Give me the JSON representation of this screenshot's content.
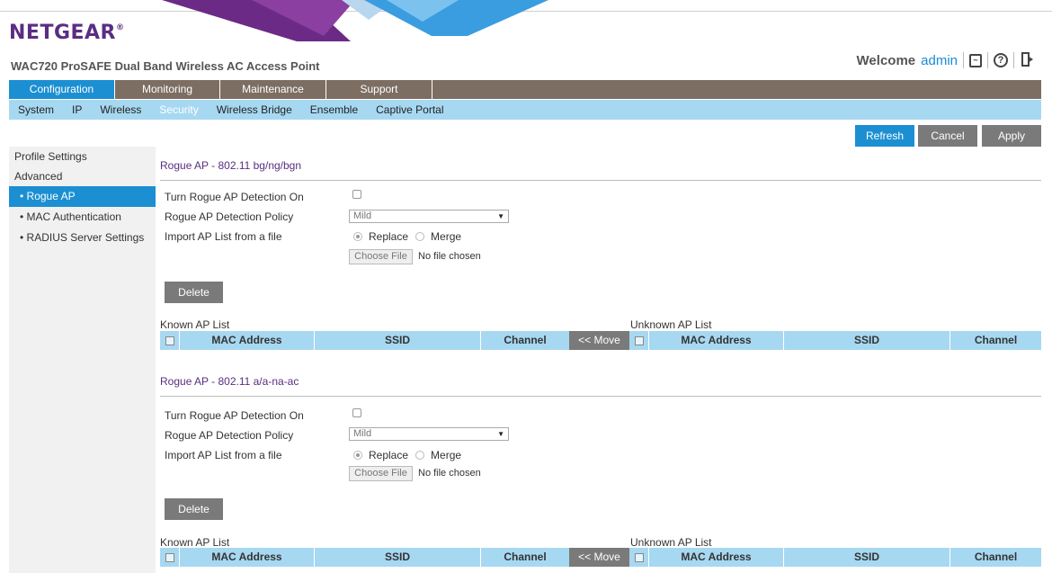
{
  "header": {
    "logo_text": "NETGEAR",
    "logo_mark": "®",
    "product_title": "WAC720 ProSAFE Dual Band Wireless AC Access Point",
    "welcome_label": "Welcome",
    "username": "admin",
    "icons": [
      "logfile-icon",
      "help-icon",
      "logout-icon"
    ],
    "brand_color": "#5a2d82"
  },
  "main_nav": [
    {
      "label": "Configuration",
      "active": true
    },
    {
      "label": "Monitoring",
      "active": false
    },
    {
      "label": "Maintenance",
      "active": false
    },
    {
      "label": "Support",
      "active": false
    }
  ],
  "sub_nav": [
    {
      "label": "System",
      "active": false
    },
    {
      "label": "IP",
      "active": false
    },
    {
      "label": "Wireless",
      "active": false
    },
    {
      "label": "Security",
      "active": true
    },
    {
      "label": "Wireless Bridge",
      "active": false
    },
    {
      "label": "Ensemble",
      "active": false
    },
    {
      "label": "Captive Portal",
      "active": false
    }
  ],
  "actions": {
    "refresh": "Refresh",
    "cancel": "Cancel",
    "apply": "Apply"
  },
  "sidebar": {
    "profile_settings": "Profile Settings",
    "advanced": "Advanced",
    "items": [
      {
        "label": "• Rogue AP",
        "active": true
      },
      {
        "label": "• MAC Authentication",
        "active": false
      },
      {
        "label": "• RADIUS Server Settings",
        "active": false
      }
    ]
  },
  "sections": [
    {
      "title": "Rogue AP - 802.11 bg/ng/bgn",
      "detection_label": "Turn Rogue AP Detection On",
      "detection_checked": false,
      "policy_label": "Rogue AP Detection Policy",
      "policy_value": "Mild",
      "import_label": "Import AP List from a file",
      "radio_replace": "Replace",
      "radio_merge": "Merge",
      "radio_selected": "Replace",
      "choose_file": "Choose File",
      "no_file": "No file chosen",
      "delete": "Delete",
      "known_list": "Known AP List",
      "unknown_list": "Unknown AP List",
      "columns": [
        "MAC Address",
        "SSID",
        "Channel"
      ],
      "move": "<< Move"
    },
    {
      "title": "Rogue AP - 802.11 a/a-na-ac",
      "detection_label": "Turn Rogue AP Detection On",
      "detection_checked": false,
      "policy_label": "Rogue AP Detection Policy",
      "policy_value": "Mild",
      "import_label": "Import AP List from a file",
      "radio_replace": "Replace",
      "radio_merge": "Merge",
      "radio_selected": "Replace",
      "choose_file": "Choose File",
      "no_file": "No file chosen",
      "delete": "Delete",
      "known_list": "Known AP List",
      "unknown_list": "Unknown AP List",
      "columns": [
        "MAC Address",
        "SSID",
        "Channel"
      ],
      "move": "<< Move"
    }
  ]
}
